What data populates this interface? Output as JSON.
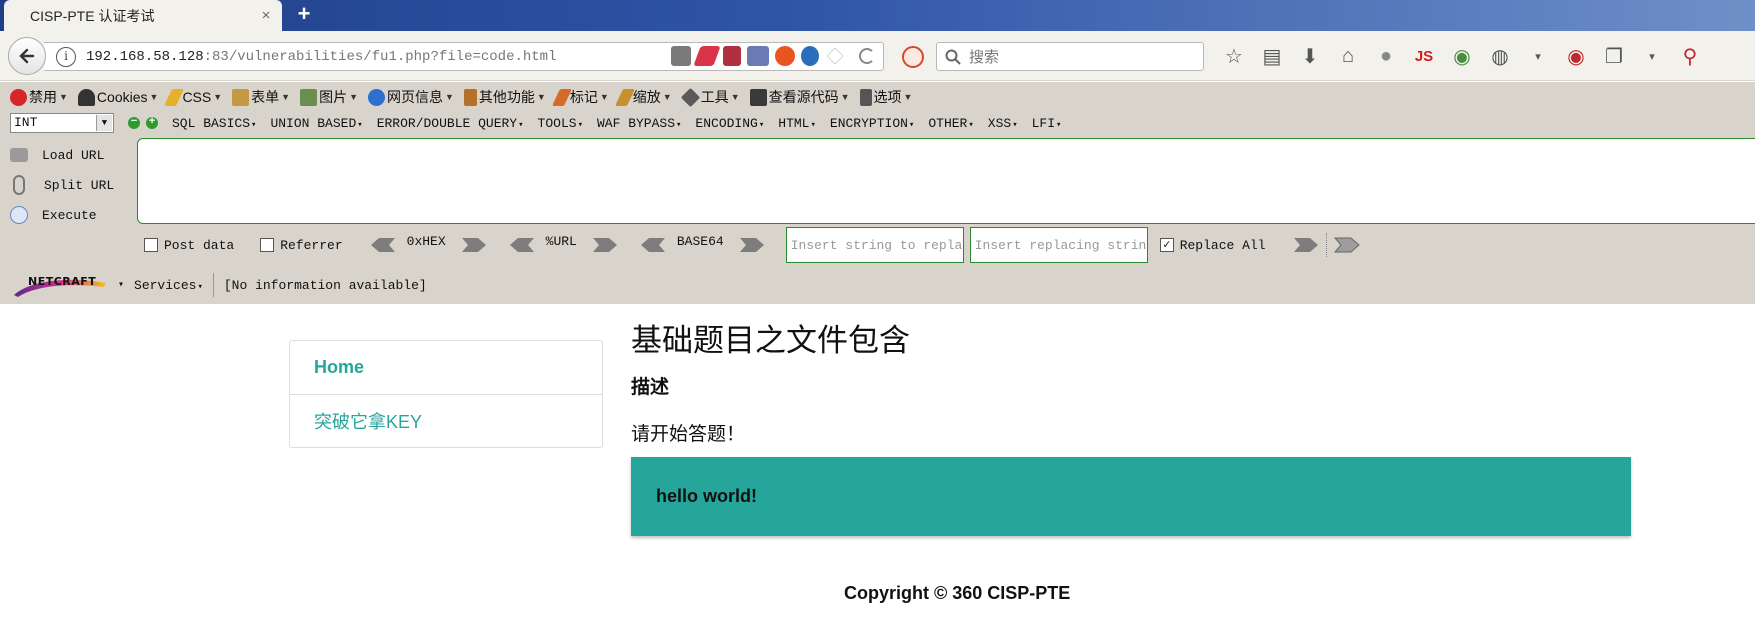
{
  "tab": {
    "title": "CISP-PTE 认证考试",
    "close": "×",
    "new_tab": "+"
  },
  "navbar": {
    "url_host": "192.168.58.128",
    "url_rest": ":83/vulnerabilities/fu1.php?file=code.html",
    "search_placeholder": "搜索"
  },
  "webdev_toolbar": {
    "items": [
      "禁用",
      "Cookies",
      "CSS",
      "表单",
      "图片",
      "网页信息",
      "其他功能",
      "标记",
      "缩放",
      "工具",
      "查看源代码",
      "选项"
    ]
  },
  "hackbar": {
    "select_value": "INT",
    "menus": [
      "SQL BASICS",
      "UNION BASED",
      "ERROR/DOUBLE QUERY",
      "TOOLS",
      "WAF BYPASS",
      "ENCODING",
      "HTML",
      "ENCRYPTION",
      "OTHER",
      "XSS",
      "LFI"
    ],
    "load_url": "Load URL",
    "split_url": "Split URL",
    "execute": "Execute",
    "post_data": "Post data",
    "referrer": "Referrer",
    "enc_hex": "0xHEX",
    "enc_url": "%URL",
    "enc_base64": "BASE64",
    "insert_string_placeholder": "Insert string to replace",
    "insert_replacing_placeholder": "Insert replacing string",
    "replace_all": "Replace All",
    "replace_all_checked": "✓"
  },
  "netcraft": {
    "logo_text": "NETCRAFT",
    "services": "Services",
    "info": "[No information available]"
  },
  "sidebar": {
    "items": [
      {
        "label": "Home"
      },
      {
        "label": "突破它拿KEY"
      }
    ]
  },
  "main": {
    "title": "基础题目之文件包含",
    "desc_heading": "描述",
    "desc_text": "请开始答题！",
    "panel_text": "hello world!"
  },
  "footer": {
    "text": "Copyright © 360 CISP-PTE"
  },
  "colors": {
    "accent": "#26a69a",
    "tabbar": "#2f55a8",
    "toolbar": "#d8d4cc"
  }
}
